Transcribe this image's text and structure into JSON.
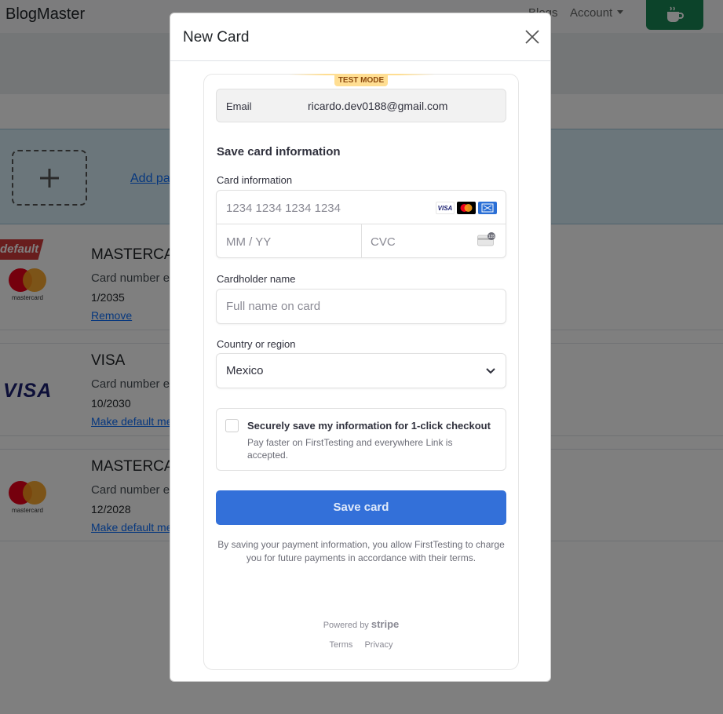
{
  "app": {
    "brand": "BlogMaster",
    "nav": {
      "blogs": "Blogs",
      "account": "Account"
    }
  },
  "add_card": {
    "link": "Add pa"
  },
  "cards": [
    {
      "badge": "default",
      "brand": "MASTERCA",
      "number": "Card number e",
      "expiry": "1/2035",
      "action": "Remove",
      "logo_text": "mastercard"
    },
    {
      "brand": "VISA",
      "number": "Card number e",
      "expiry": "10/2030",
      "action": "Make default me",
      "logo_text": "VISA"
    },
    {
      "brand": "MASTERCA",
      "number": "Card number e",
      "expiry": "12/2028",
      "action": "Make default me",
      "logo_text": "mastercard"
    }
  ],
  "modal": {
    "title": "New Card",
    "test_mode": "TEST MODE",
    "email_label": "Email",
    "email_value": "ricardo.dev0188@gmail.com",
    "section_title": "Save card information",
    "card_info_label": "Card information",
    "card_number_placeholder": "1234 1234 1234 1234",
    "expiry_placeholder": "MM / YY",
    "cvc_placeholder": "CVC",
    "card_brands": [
      "VISA",
      "mastercard",
      "amex"
    ],
    "cardholder_label": "Cardholder name",
    "cardholder_placeholder": "Full name on card",
    "country_label": "Country or region",
    "country_value": "Mexico",
    "link_title": "Securely save my information for 1-click checkout",
    "link_desc": "Pay faster on FirstTesting and everywhere Link is accepted.",
    "save_button": "Save card",
    "terms": "By saving your payment information, you allow FirstTesting to charge you for future payments in accordance with their terms.",
    "powered_by": "Powered by",
    "stripe": "stripe",
    "footer_terms": "Terms",
    "footer_privacy": "Privacy"
  },
  "colors": {
    "primary_button": "#3370d9",
    "test_mode": "#ffde92",
    "default_badge": "#d13b3b",
    "coffee_button": "#198754"
  }
}
